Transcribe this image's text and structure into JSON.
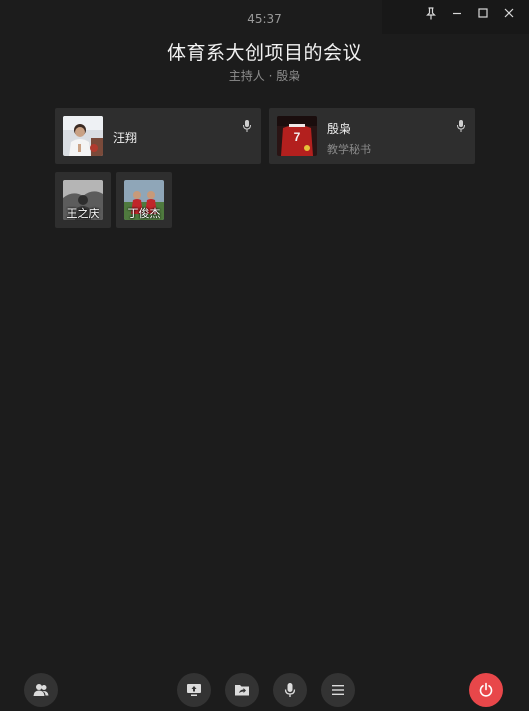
{
  "window": {
    "controls": {
      "pin_icon": "pin-icon",
      "minimize_icon": "minimize-icon",
      "maximize_icon": "maximize-icon",
      "close_icon": "close-icon"
    }
  },
  "meeting": {
    "timer": "45:37",
    "title": "体育系大创项目的会议",
    "host_line": "主持人 · 殷枭"
  },
  "participants_featured": [
    {
      "name": "汪翔",
      "role": "",
      "mic_icon": "microphone-icon"
    },
    {
      "name": "殷枭",
      "role": "教学秘书",
      "mic_icon": "microphone-icon",
      "jersey_number": "7"
    }
  ],
  "participants_small": [
    {
      "name": "王之庆"
    },
    {
      "name": "丁俊杰"
    }
  ],
  "toolbar": {
    "members_icon": "members-icon",
    "share_screen_icon": "share-screen-icon",
    "share_file_icon": "share-file-icon",
    "microphone_icon": "microphone-icon",
    "more_menu_icon": "menu-icon",
    "end_meeting_icon": "power-icon",
    "end_color": "#e8474a"
  }
}
